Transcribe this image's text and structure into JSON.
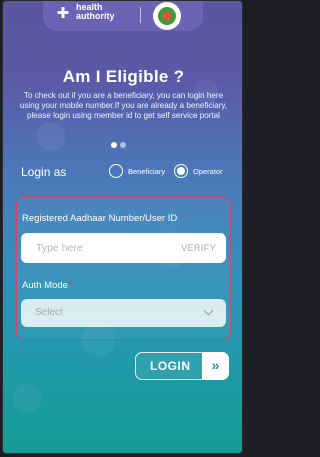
{
  "header": {
    "logo_line1": "health",
    "logo_line2": "authority",
    "logo_icon": "heart-cross-icon",
    "emblem_icon": "emblem-icon"
  },
  "main": {
    "title": "Am I Eligible ?",
    "description": "To check out if you are a beneficiary, you can login here using your mobile number.If you are already a beneficiary, please login using member id to get self service portal",
    "carousel": {
      "pages": 2,
      "active": 1
    }
  },
  "login_as": {
    "label": "Login as",
    "options": [
      {
        "label": "Beneficiary",
        "selected": false
      },
      {
        "label": "Operator",
        "selected": true
      }
    ]
  },
  "form": {
    "user_id_label": "Registered Aadhaar Number/User ID",
    "user_id_required": "*",
    "user_id_placeholder": "Type here",
    "verify_label": "VERIFY",
    "auth_mode_label": "Auth Mode",
    "auth_mode_required": "*",
    "auth_mode_placeholder": "Select"
  },
  "login_button": {
    "label": "LOGIN",
    "arrow": "»"
  },
  "colors": {
    "accent_border": "#d2446a",
    "required": "#e5365a",
    "header": "#6b63b3"
  }
}
